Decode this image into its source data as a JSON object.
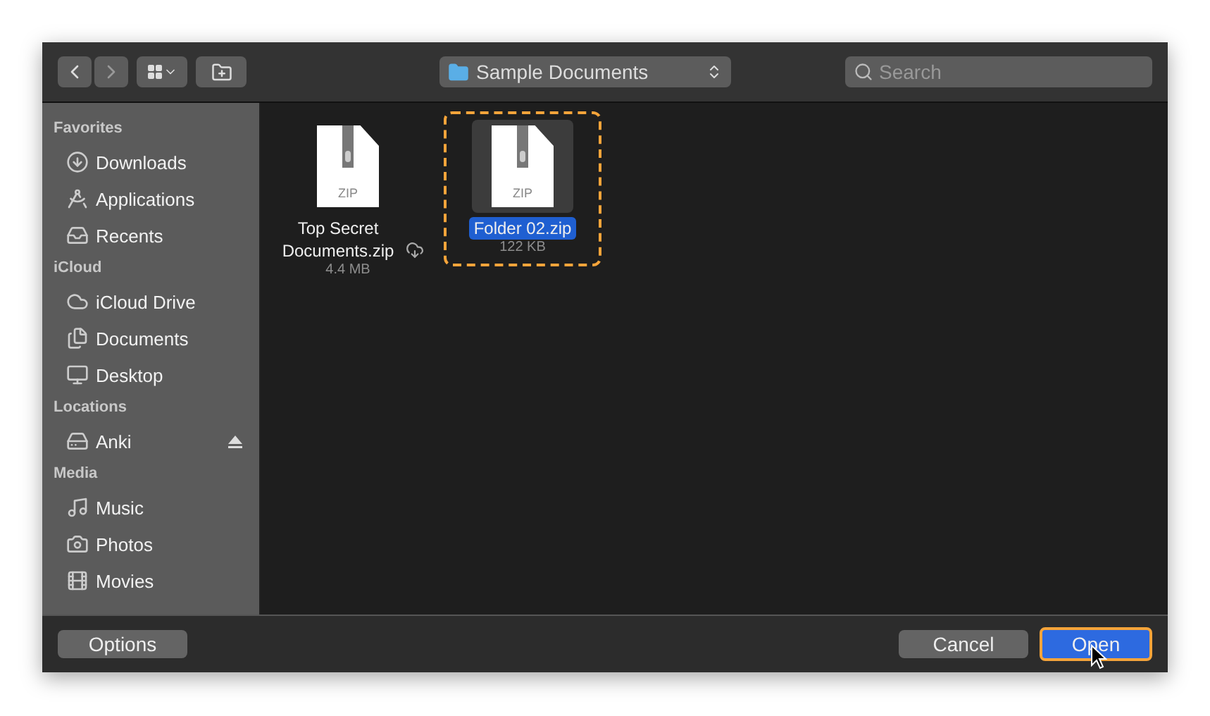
{
  "toolbar": {
    "location": "Sample Documents",
    "search": {
      "placeholder": "Search"
    }
  },
  "sidebar": {
    "sections": [
      {
        "title": "Favorites",
        "items": [
          {
            "label": "Downloads",
            "ejectable": false
          },
          {
            "label": "Applications",
            "ejectable": false
          },
          {
            "label": "Recents",
            "ejectable": false
          }
        ]
      },
      {
        "title": "iCloud",
        "items": [
          {
            "label": "iCloud Drive",
            "ejectable": false
          },
          {
            "label": "Documents",
            "ejectable": false
          },
          {
            "label": "Desktop",
            "ejectable": false
          }
        ]
      },
      {
        "title": "Locations",
        "items": [
          {
            "label": "Anki",
            "ejectable": true
          }
        ]
      },
      {
        "title": "Media",
        "items": [
          {
            "label": "Music",
            "ejectable": false
          },
          {
            "label": "Photos",
            "ejectable": false
          },
          {
            "label": "Movies",
            "ejectable": false
          }
        ]
      }
    ]
  },
  "files": [
    {
      "name": "Top Secret Documents.zip",
      "type_label": "ZIP",
      "size": "4.4 MB",
      "in_cloud": true,
      "selected": false,
      "highlighted": false
    },
    {
      "name": "Folder 02.zip",
      "type_label": "ZIP",
      "size": "122 KB",
      "in_cloud": false,
      "selected": true,
      "highlighted": true
    }
  ],
  "buttons": {
    "options": "Options",
    "cancel": "Cancel",
    "open": {
      "label": "Open",
      "highlighted": true
    }
  }
}
